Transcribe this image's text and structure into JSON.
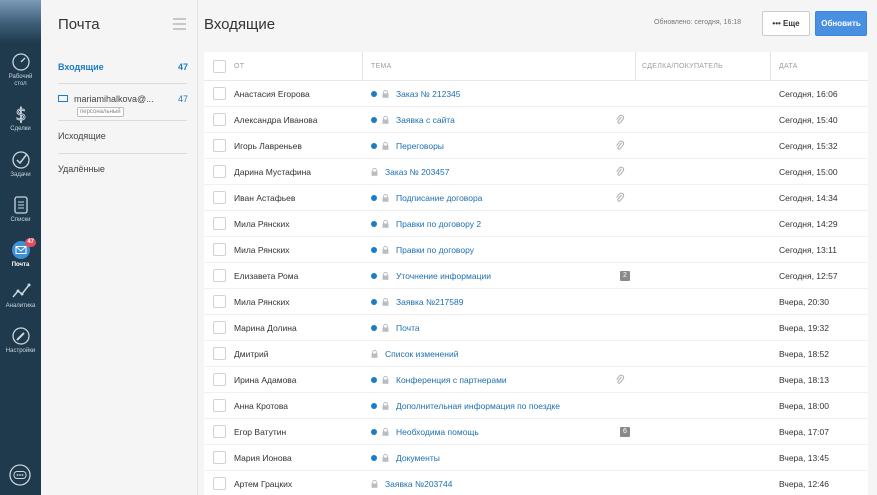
{
  "nav": {
    "items": [
      {
        "label_1": "Рабочий",
        "label_2": "стол",
        "icon": "speedometer-icon"
      },
      {
        "label_1": "Сделки",
        "label_2": "",
        "icon": "dollar-icon"
      },
      {
        "label_1": "Задачи",
        "label_2": "",
        "icon": "check-icon"
      },
      {
        "label_1": "Списки",
        "label_2": "",
        "icon": "list-icon"
      },
      {
        "label_1": "Почта",
        "label_2": "",
        "icon": "mail-icon",
        "badge": "47"
      },
      {
        "label_1": "Аналитика",
        "label_2": "",
        "icon": "chart-icon"
      },
      {
        "label_1": "Настройки",
        "label_2": "",
        "icon": "wrench-icon"
      }
    ]
  },
  "folders": {
    "title": "Почта",
    "inbox": {
      "label": "Входящие",
      "count": "47"
    },
    "account": {
      "label": "mariamihalkova@...",
      "count": "47",
      "tag": "персональный"
    },
    "outbox": {
      "label": "Исходящие"
    },
    "deleted": {
      "label": "Удалённые"
    }
  },
  "header": {
    "title": "Входящие",
    "updated": "Обновлено: сегодня, 16:18",
    "more_label": "Еще",
    "update_label": "Обновить"
  },
  "table": {
    "columns": {
      "from": "ОТ",
      "subject": "ТЕМА",
      "deal": "СДЕЛКА/ПОКУПАТЕЛЬ",
      "date": "ДАТА"
    },
    "rows": [
      {
        "from": "Анастасия Егорова",
        "subject": "Заказ № 212345",
        "date": "Сегодня, 16:06",
        "unread": true,
        "attach": false,
        "count": ""
      },
      {
        "from": "Александра Иванова",
        "subject": "Заявка с сайта",
        "date": "Сегодня, 15:40",
        "unread": true,
        "attach": true,
        "count": ""
      },
      {
        "from": "Игорь Лавреньев",
        "subject": "Переговоры",
        "date": "Сегодня, 15:32",
        "unread": true,
        "attach": true,
        "count": ""
      },
      {
        "from": "Дарина Мустафина",
        "subject": "Заказ № 203457",
        "date": "Сегодня, 15:00",
        "unread": false,
        "attach": true,
        "count": ""
      },
      {
        "from": "Иван Астафьев",
        "subject": "Подписание договора",
        "date": "Сегодня, 14:34",
        "unread": true,
        "attach": true,
        "count": ""
      },
      {
        "from": "Мила Рянских",
        "subject": "Правки по договору 2",
        "date": "Сегодня, 14:29",
        "unread": true,
        "attach": false,
        "count": ""
      },
      {
        "from": "Мила Рянских",
        "subject": "Правки по договору",
        "date": "Сегодня, 13:11",
        "unread": true,
        "attach": false,
        "count": ""
      },
      {
        "from": "Елизавета Рома",
        "subject": "Уточнение информации",
        "date": "Сегодня, 12:57",
        "unread": true,
        "attach": false,
        "count": "2"
      },
      {
        "from": "Мила Рянских",
        "subject": "Заявка №217589",
        "date": "Вчера, 20:30",
        "unread": true,
        "attach": false,
        "count": ""
      },
      {
        "from": "Марина Долина",
        "subject": "Почта",
        "date": "Вчера, 19:32",
        "unread": true,
        "attach": false,
        "count": ""
      },
      {
        "from": "Дмитрий",
        "subject": "Список изменений",
        "date": "Вчера, 18:52",
        "unread": false,
        "attach": false,
        "count": ""
      },
      {
        "from": "Ирина Адамова",
        "subject": "Конференция с партнерами",
        "date": "Вчера, 18:13",
        "unread": true,
        "attach": true,
        "count": ""
      },
      {
        "from": "Анна Кротова",
        "subject": "Дополнительная информация по поездке",
        "date": "Вчера, 18:00",
        "unread": true,
        "attach": false,
        "count": ""
      },
      {
        "from": "Егор Ватутин",
        "subject": "Необходима помощь",
        "date": "Вчера, 17:07",
        "unread": true,
        "attach": false,
        "count": "6"
      },
      {
        "from": "Мария Ионова",
        "subject": "Документы",
        "date": "Вчера, 13:45",
        "unread": true,
        "attach": false,
        "count": ""
      },
      {
        "from": "Артем Грацких",
        "subject": "Заявка №203744",
        "date": "Вчера, 12:46",
        "unread": false,
        "attach": false,
        "count": ""
      }
    ]
  },
  "colors": {
    "accent": "#1d7cc5",
    "rail": "#1f3a4d",
    "badge": "#e64a5c",
    "button": "#4a90e2"
  }
}
